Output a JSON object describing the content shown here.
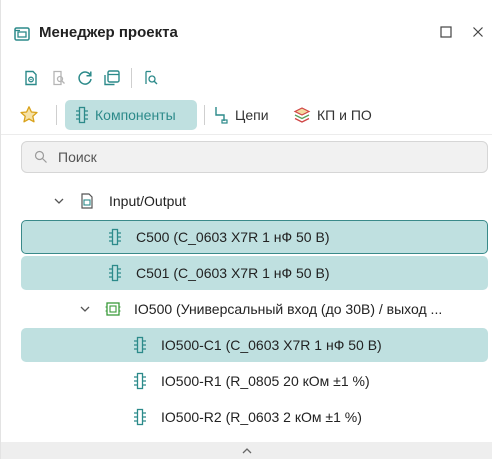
{
  "window": {
    "title": "Менеджер проекта"
  },
  "tabs": [
    {
      "label": "Компоненты",
      "active": true
    },
    {
      "label": "Цепи",
      "active": false
    },
    {
      "label": "КП и ПО",
      "active": false
    }
  ],
  "search": {
    "placeholder": "Поиск",
    "value": ""
  },
  "tree": [
    {
      "label": "Input/Output",
      "type": "folder",
      "level": 1,
      "expanded": true,
      "selected": false
    },
    {
      "label": "C500 (C_0603 X7R 1 нФ 50 В)",
      "type": "component",
      "level": 2,
      "selected": true,
      "focused": true
    },
    {
      "label": "C501 (C_0603 X7R 1 нФ 50 В)",
      "type": "component",
      "level": 2,
      "selected": true
    },
    {
      "label": "IO500 (Универсальный вход (до 30В) / выход ...",
      "type": "block",
      "level": 2,
      "expanded": true,
      "selected": false
    },
    {
      "label": "IO500-C1 (C_0603 X7R 1 нФ 50 В)",
      "type": "component",
      "level": 3,
      "selected": true
    },
    {
      "label": "IO500-R1 (R_0805 20 кОм ±1 %)",
      "type": "component",
      "level": 3,
      "selected": false
    },
    {
      "label": "IO500-R2 (R_0603 2 кОм ±1 %)",
      "type": "component",
      "level": 3,
      "selected": false
    }
  ],
  "colors": {
    "accent": "#2c8a8a",
    "selection": "#bfe0e0",
    "focus_border": "#3a8a8a",
    "star": "#d9a21b",
    "layers": "#d04545"
  },
  "icons": [
    "project-manager-icon",
    "maximize-icon",
    "close-icon",
    "document-view-icon",
    "zoom-select-icon",
    "refresh-icon",
    "copy-window-icon",
    "find-icon",
    "favorites-star-icon",
    "component-icon",
    "net-icon",
    "pad-layers-icon",
    "search-icon",
    "chevron-down-icon",
    "document-icon",
    "block-icon",
    "chevron-up-icon"
  ]
}
